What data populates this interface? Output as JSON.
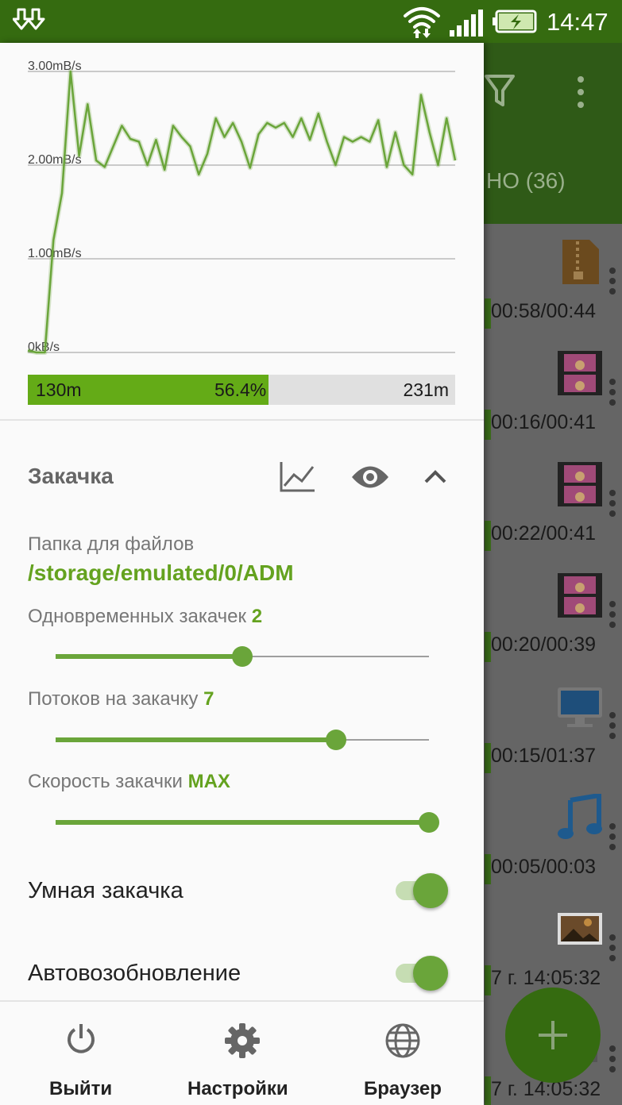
{
  "status_bar": {
    "time": "14:47"
  },
  "background_list": {
    "tab_text": "НО (36)",
    "rows": [
      {
        "time": "00:58/00:44",
        "thumb": "zip-archive-icon"
      },
      {
        "time": "00:16/00:41",
        "thumb": "video-file-icon"
      },
      {
        "time": "00:22/00:41",
        "thumb": "video-file-icon"
      },
      {
        "time": "00:20/00:39",
        "thumb": "video-file-icon"
      },
      {
        "time": "00:15/01:37",
        "thumb": "monitor-file-icon"
      },
      {
        "time": "00:05/00:03",
        "thumb": "music-file-icon"
      },
      {
        "time": "7 г. 14:05:32",
        "thumb": "image-file-icon"
      },
      {
        "time": "7 г. 14:05:32",
        "thumb": "file-icon"
      }
    ]
  },
  "chart_data": {
    "type": "line",
    "title": "",
    "xlabel": "",
    "ylabel": "",
    "y_unit": "mB/s",
    "ylim": [
      0,
      3.0
    ],
    "yticks": [
      {
        "value": 0,
        "label": "0kB/s"
      },
      {
        "value": 1.0,
        "label": "1.00mB/s"
      },
      {
        "value": 2.0,
        "label": "2.00mB/s"
      },
      {
        "value": 3.0,
        "label": "3.00mB/s"
      }
    ],
    "grid": true,
    "series": [
      {
        "color": "#6aa53a",
        "values": [
          0.02,
          0.0,
          0.0,
          1.2,
          1.7,
          3.0,
          2.1,
          2.65,
          2.05,
          1.98,
          2.2,
          2.42,
          2.28,
          2.25,
          2.0,
          2.27,
          1.95,
          2.42,
          2.3,
          2.2,
          1.9,
          2.12,
          2.5,
          2.3,
          2.45,
          2.25,
          1.97,
          2.33,
          2.45,
          2.4,
          2.45,
          2.3,
          2.5,
          2.27,
          2.55,
          2.25,
          2.0,
          2.3,
          2.25,
          2.3,
          2.25,
          2.48,
          1.98,
          2.35,
          2.0,
          1.9,
          2.75,
          2.35,
          2.0,
          2.5,
          2.05
        ]
      }
    ]
  },
  "progress": {
    "downloaded": "130m",
    "percent": "56.4%",
    "fraction": 0.564,
    "total": "231m"
  },
  "section": {
    "title": "Закачка",
    "folder_label": "Папка для файлов",
    "folder_path": "/storage/emulated/0/ADM",
    "concurrent_label": "Одновременных закачек",
    "concurrent_value": "2",
    "concurrent_fraction": 0.5,
    "threads_label": "Потоков на закачку",
    "threads_value": "7",
    "threads_fraction": 0.75,
    "speed_label": "Скорость закачки",
    "speed_value": "MAX",
    "speed_fraction": 1.0
  },
  "toggles": [
    {
      "label": "Умная закачка",
      "on": true
    },
    {
      "label": "Автовозобновление",
      "on": true
    }
  ],
  "nav": {
    "exit": "Выйти",
    "settings": "Настройки",
    "browser": "Браузер"
  },
  "colors": {
    "accent": "#6aa53a",
    "status_bar": "#356b10",
    "progress_fill": "#64ab17"
  }
}
